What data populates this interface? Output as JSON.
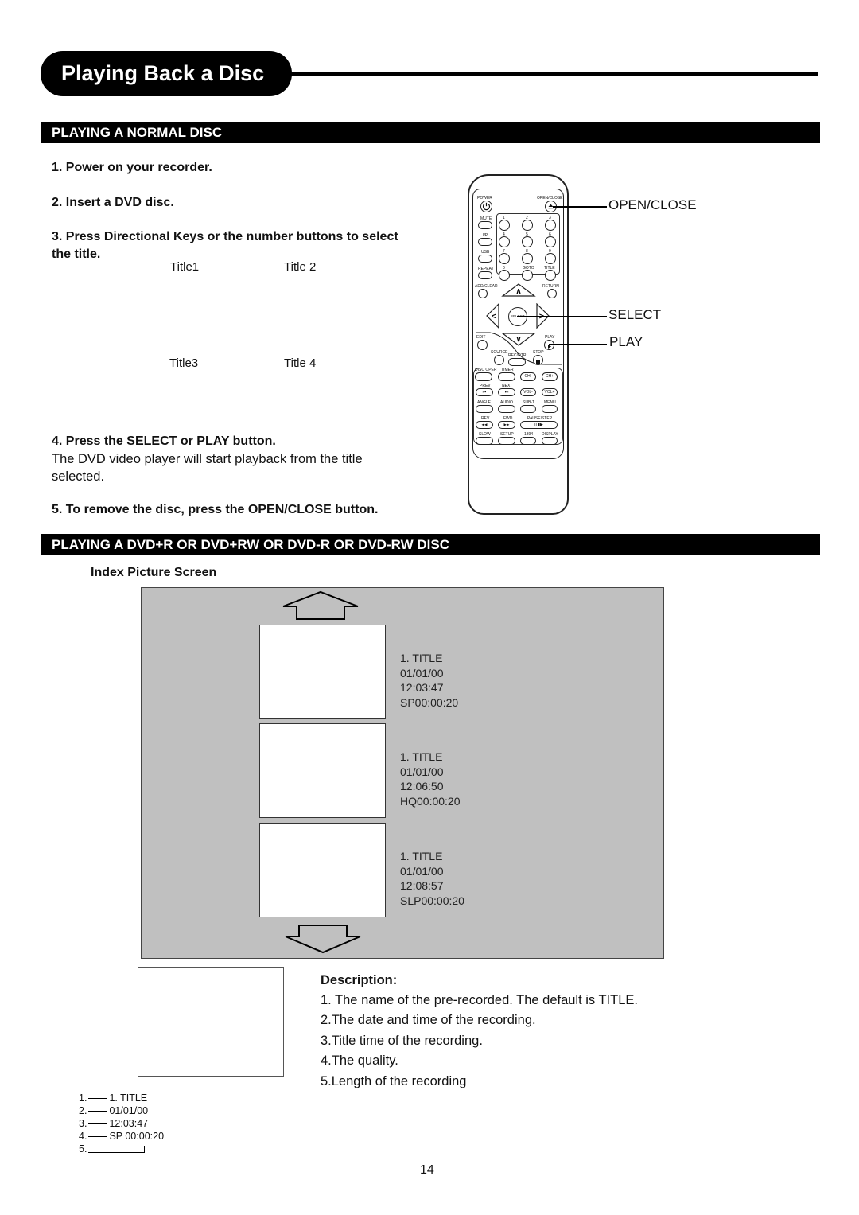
{
  "header": {
    "title": "Playing Back a Disc"
  },
  "section_normal": {
    "heading": "PLAYING A NORMAL DISC",
    "steps": [
      "1. Power on your recorder.",
      "2. Insert a DVD disc.",
      "3. Press Directional  Keys or the number buttons to select",
      "the title."
    ],
    "titles": [
      "Title1",
      "Title 2",
      "Title3",
      "Title 4"
    ],
    "step4": "4. Press the SELECT or PLAY button.",
    "step4_desc_line1": "The DVD video player will start playback from the title",
    "step4_desc_line2": "selected.",
    "step5": "5. To remove the disc, press the OPEN/CLOSE button."
  },
  "remote": {
    "labels": {
      "power": "POWER",
      "open_close": "OPEN/CLOSE",
      "mute": "MUTE",
      "ip": "I/P",
      "usb": "USB",
      "repeat": "REPEAT",
      "goto": "GOTO",
      "title": "TITLE",
      "add_clear": "ADD/CLEAR",
      "return": "RETURN",
      "select": "SELECT",
      "edit": "EDIT",
      "play": "PLAY",
      "source": "SOURCE",
      "rec_otr": "REC/OTR",
      "stop": "STOP",
      "disc_oper": "DISC OPER",
      "timer": "TIMER",
      "ch_minus": "CH-",
      "ch_plus": "CH+",
      "prev": "PREV",
      "next": "NEXT",
      "vol_minus": "VOL-",
      "vol_plus": "VOL+",
      "angle": "ANGLE",
      "audio": "AUDIO",
      "sub_t": "SUB-T",
      "menu": "MENU",
      "rev": "REV",
      "fwd": "FWD",
      "pause_step": "PAUSE/STEP",
      "slow": "SLOW",
      "setup": "SETUP",
      "k1394": "1394",
      "display": "DISPLAY",
      "up": "∧",
      "down": "∨",
      "left": "<",
      "right": ">",
      "n1": "1",
      "n2": "2",
      "n3": "3",
      "n4": "4",
      "n5": "5",
      "n6": "6",
      "n7": "7",
      "n8": "8",
      "n9": "9",
      "n0": "0",
      "prev_glyph": "⏮",
      "next_glyph": "⏭",
      "rev_glyph": "◀◀",
      "fwd_glyph": "▶▶",
      "pause_glyph": "II ▮▶"
    },
    "callouts": {
      "open_close": "OPEN/CLOSE",
      "select": "SELECT",
      "play": "PLAY"
    }
  },
  "section_dvdr": {
    "heading": "PLAYING A DVD+R OR DVD+RW OR DVD-R OR DVD-RW DISC",
    "subheading": "Index Picture Screen",
    "entries": [
      {
        "name": "1. TITLE",
        "date": "01/01/00",
        "time": "12:03:47",
        "quality_length": "SP00:00:20"
      },
      {
        "name": "1. TITLE",
        "date": "01/01/00",
        "time": "12:06:50",
        "quality_length": "HQ00:00:20"
      },
      {
        "name": "1. TITLE",
        "date": "01/01/00",
        "time": "12:08:57",
        "quality_length": "SLP00:00:20"
      }
    ],
    "legend": [
      {
        "num": "1.",
        "value": "1. TITLE"
      },
      {
        "num": "2.",
        "value": "01/01/00"
      },
      {
        "num": "3.",
        "value": "12:03:47"
      },
      {
        "num": "4.",
        "value": "SP 00:00:20"
      },
      {
        "num": "5.",
        "value": ""
      }
    ],
    "description": {
      "heading": "Description:",
      "items": [
        "1. The name of the pre-recorded. The default is TITLE.",
        "2.The date and time of the recording.",
        "3.Title time of the recording.",
        "4.The quality.",
        "5.Length of the recording"
      ]
    }
  },
  "page_number": "14"
}
